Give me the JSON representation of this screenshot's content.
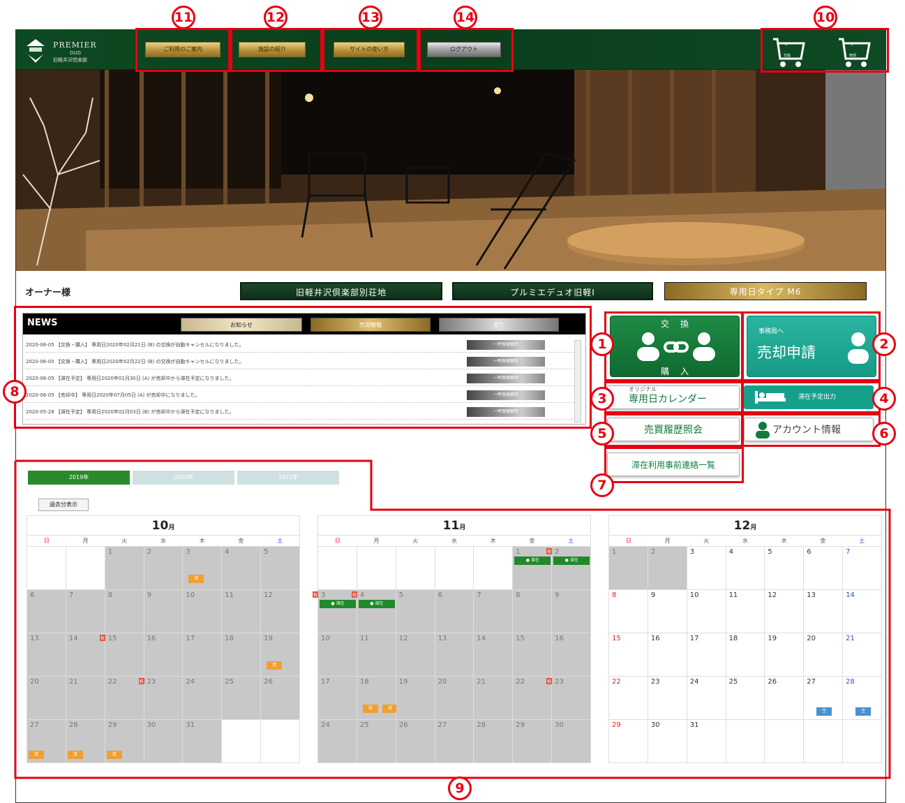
{
  "header": {
    "logo": {
      "line1": "PREMIER",
      "line2": "DUO",
      "line3": "旧軽井沢倶楽部"
    },
    "nav": [
      {
        "label": "ご利用のご案内"
      },
      {
        "label": "施設の紹介"
      },
      {
        "label": "サイトの使い方"
      },
      {
        "label": "ログアウト"
      }
    ],
    "carts": [
      {
        "count": "0",
        "label": "交換"
      },
      {
        "count": "0",
        "label": "売却"
      }
    ]
  },
  "owner_label": "オーナー様",
  "properties": [
    {
      "label": "旧軽井沢倶楽部別荘地"
    },
    {
      "label": "プルミエデュオ旧軽Ⅰ"
    },
    {
      "label": "専用日タイプ M6"
    }
  ],
  "news": {
    "title": "NEWS",
    "tabs": [
      "お知らせ",
      "売却情報",
      "全て"
    ],
    "items": [
      {
        "text": "2020-06-05 【交換・購入】 専用日2020年02月21日 (B) の交換が自動キャンセルになりました。",
        "button": "一時保留解除"
      },
      {
        "text": "2020-06-05 【交換・購入】 専用日2020年02月22日 (B) の交換が自動キャンセルになりました。",
        "button": "一時保留解除"
      },
      {
        "text": "2020-06-05 【滞在予定】 専用日2020年01月30日 (A) が売却中から滞在予定になりました。",
        "button": "一時保留解除"
      },
      {
        "text": "2020-06-05 【売却中】 専用日2020年07月05日 (A) が売却中になりました。",
        "button": "一時保留解除"
      },
      {
        "text": "2020-05-28 【滞在予定】 専用日2020年02月03日 (B) が売却中から滞在予定になりました。",
        "button": "一時保留解除"
      }
    ]
  },
  "actions": {
    "exchange": {
      "top": "交　換",
      "bottom": "購　入"
    },
    "sell": {
      "line1": "事務局へ",
      "line2": "売却申請"
    },
    "calendar": {
      "small": "オリジナル",
      "label": "専用日カレンダー"
    },
    "stay": {
      "label": "滞在予定出力"
    },
    "history": {
      "label": "売買履歴照会"
    },
    "account": {
      "label": "アカウント情報"
    },
    "contacts": {
      "label": "滞在利用事前連絡一覧"
    }
  },
  "annotations": [
    "1",
    "2",
    "3",
    "4",
    "5",
    "6",
    "7",
    "8",
    "9",
    "10",
    "11",
    "12",
    "13",
    "14"
  ],
  "year_tabs": [
    "2019年",
    "2020年",
    "2021年"
  ],
  "past_button": "過去分表示",
  "weekdays": [
    "日",
    "月",
    "火",
    "水",
    "木",
    "金",
    "土"
  ],
  "months": [
    {
      "num": "10",
      "unit": "月",
      "cells": [
        {
          "d": "",
          "g": false
        },
        {
          "d": "",
          "g": false
        },
        {
          "d": "1",
          "g": true
        },
        {
          "d": "2",
          "g": true
        },
        {
          "d": "3",
          "g": true,
          "tags": [
            {
              "t": "済",
              "c": "or"
            }
          ]
        },
        {
          "d": "4",
          "g": true
        },
        {
          "d": "5",
          "g": true
        },
        {
          "d": "6",
          "g": true
        },
        {
          "d": "7",
          "g": true
        },
        {
          "d": "8",
          "g": true
        },
        {
          "d": "9",
          "g": true
        },
        {
          "d": "10",
          "g": true
        },
        {
          "d": "11",
          "g": true
        },
        {
          "d": "12",
          "g": true
        },
        {
          "d": "13",
          "g": true
        },
        {
          "d": "14",
          "g": true
        },
        {
          "d": "15",
          "g": true,
          "hol": "祝"
        },
        {
          "d": "16",
          "g": true
        },
        {
          "d": "17",
          "g": true
        },
        {
          "d": "18",
          "g": true
        },
        {
          "d": "19",
          "g": true,
          "tags": [
            {
              "t": "済",
              "c": "or"
            }
          ]
        },
        {
          "d": "20",
          "g": true
        },
        {
          "d": "21",
          "g": true
        },
        {
          "d": "22",
          "g": true
        },
        {
          "d": "23",
          "g": true,
          "hol": "祝"
        },
        {
          "d": "24",
          "g": true
        },
        {
          "d": "25",
          "g": true
        },
        {
          "d": "26",
          "g": true
        },
        {
          "d": "27",
          "g": true,
          "tags": [
            {
              "t": "済",
              "c": "or"
            }
          ]
        },
        {
          "d": "28",
          "g": true,
          "tags": [
            {
              "t": "済",
              "c": "or"
            }
          ]
        },
        {
          "d": "29",
          "g": true,
          "tags": [
            {
              "t": "済",
              "c": "or"
            }
          ]
        },
        {
          "d": "30",
          "g": true
        },
        {
          "d": "31",
          "g": true
        },
        {
          "d": "",
          "g": false
        },
        {
          "d": "",
          "g": false
        }
      ]
    },
    {
      "num": "11",
      "unit": "月",
      "cells": [
        {
          "d": "",
          "g": false
        },
        {
          "d": "",
          "g": false
        },
        {
          "d": "",
          "g": false
        },
        {
          "d": "",
          "g": false
        },
        {
          "d": "",
          "g": false
        },
        {
          "d": "1",
          "g": true,
          "tags": [
            {
              "t": "● 滞在",
              "c": "gr"
            }
          ]
        },
        {
          "d": "2",
          "g": true,
          "hol": "祝",
          "tags": [
            {
              "t": "● 滞在",
              "c": "gr"
            }
          ]
        },
        {
          "d": "3",
          "g": true,
          "hol": "祝",
          "tags": [
            {
              "t": "● 滞在",
              "c": "gr"
            }
          ]
        },
        {
          "d": "4",
          "g": true,
          "hol": "祝",
          "tags": [
            {
              "t": "● 滞在",
              "c": "gr"
            }
          ]
        },
        {
          "d": "5",
          "g": true
        },
        {
          "d": "6",
          "g": true
        },
        {
          "d": "7",
          "g": true
        },
        {
          "d": "8",
          "g": true
        },
        {
          "d": "9",
          "g": true
        },
        {
          "d": "10",
          "g": true
        },
        {
          "d": "11",
          "g": true
        },
        {
          "d": "12",
          "g": true
        },
        {
          "d": "13",
          "g": true
        },
        {
          "d": "14",
          "g": true
        },
        {
          "d": "15",
          "g": true
        },
        {
          "d": "16",
          "g": true
        },
        {
          "d": "17",
          "g": true
        },
        {
          "d": "18",
          "g": true,
          "tags": [
            {
              "t": "済",
              "c": "or"
            },
            {
              "t": "済",
              "c": "or"
            }
          ]
        },
        {
          "d": "19",
          "g": true
        },
        {
          "d": "20",
          "g": true
        },
        {
          "d": "21",
          "g": true
        },
        {
          "d": "22",
          "g": true
        },
        {
          "d": "23",
          "g": true,
          "hol": "祝"
        },
        {
          "d": "24",
          "g": true
        },
        {
          "d": "25",
          "g": true
        },
        {
          "d": "26",
          "g": true
        },
        {
          "d": "27",
          "g": true
        },
        {
          "d": "28",
          "g": true
        },
        {
          "d": "29",
          "g": true
        },
        {
          "d": "30",
          "g": true
        }
      ]
    },
    {
      "num": "12",
      "unit": "月",
      "cells": [
        {
          "d": "1",
          "g": true
        },
        {
          "d": "2",
          "g": true
        },
        {
          "d": "3",
          "g": false
        },
        {
          "d": "4",
          "g": false
        },
        {
          "d": "5",
          "g": false
        },
        {
          "d": "6",
          "g": false
        },
        {
          "d": "7",
          "g": false
        },
        {
          "d": "8",
          "g": false
        },
        {
          "d": "9",
          "g": false
        },
        {
          "d": "10",
          "g": false
        },
        {
          "d": "11",
          "g": false
        },
        {
          "d": "12",
          "g": false
        },
        {
          "d": "13",
          "g": false
        },
        {
          "d": "14",
          "g": false
        },
        {
          "d": "15",
          "g": false
        },
        {
          "d": "16",
          "g": false
        },
        {
          "d": "17",
          "g": false
        },
        {
          "d": "18",
          "g": false
        },
        {
          "d": "19",
          "g": false
        },
        {
          "d": "20",
          "g": false
        },
        {
          "d": "21",
          "g": false
        },
        {
          "d": "22",
          "g": false
        },
        {
          "d": "23",
          "g": false
        },
        {
          "d": "24",
          "g": false
        },
        {
          "d": "25",
          "g": false
        },
        {
          "d": "26",
          "g": false
        },
        {
          "d": "27",
          "g": false,
          "tags": [
            {
              "t": "空",
              "c": "bl"
            }
          ]
        },
        {
          "d": "28",
          "g": false,
          "tags": [
            {
              "t": "空",
              "c": "bl"
            }
          ]
        },
        {
          "d": "29",
          "g": false
        },
        {
          "d": "30",
          "g": false
        },
        {
          "d": "31",
          "g": false
        },
        {
          "d": "",
          "g": false
        },
        {
          "d": "",
          "g": false
        },
        {
          "d": "",
          "g": false
        },
        {
          "d": "",
          "g": false
        }
      ]
    }
  ]
}
